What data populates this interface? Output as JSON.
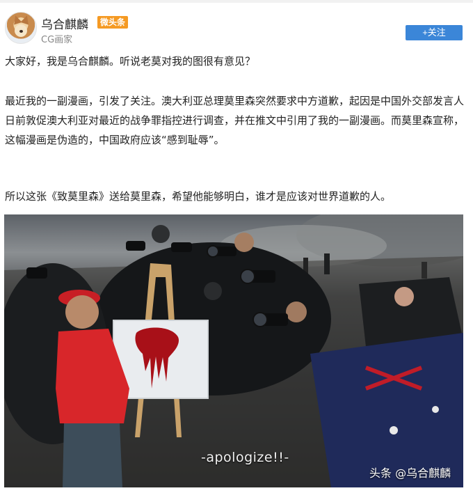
{
  "header": {
    "username": "乌合麒麟",
    "badge": "微头条",
    "subtitle": "CG画家",
    "follow_label": "+关注"
  },
  "post": {
    "paragraphs": [
      "大家好，我是乌合麒麟。听说老莫对我的图很有意见？",
      "最近我的一副漫画，引发了关注。澳大利亚总理莫里森突然要求中方道歉，起因是中国外交部发言人日前敦促澳大利亚对最近的战争罪指控进行调查，并在推文中引用了我的一副漫画。而莫里森宣称，这幅漫画是伪造的，中国政府应该“感到耻辱”。",
      "所以这张《致莫里森》送给莫里森，希望他能够明白，谁才是应该对世界道歉的人。"
    ]
  },
  "image": {
    "caption": "-apologize!!-",
    "watermark": "头条 @乌合麒麟"
  },
  "colors": {
    "badge": "#f59a23",
    "follow_button": "#3b86d8",
    "shirt_red": "#d8262a",
    "blood_red": "#a81018"
  },
  "icons": [
    "avatar-shiba-icon"
  ]
}
